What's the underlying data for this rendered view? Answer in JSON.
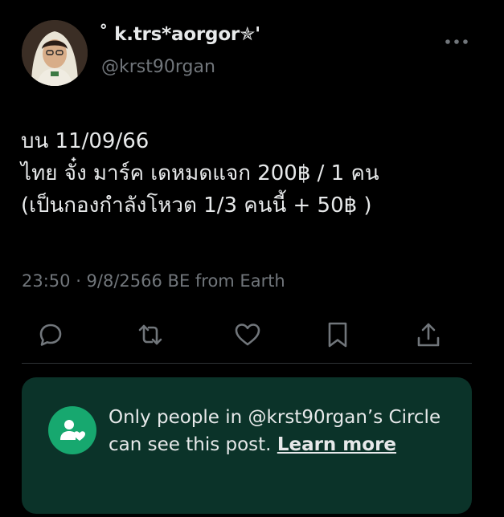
{
  "author": {
    "display_name": "˚ k.trs*aorgor✯'",
    "handle": "@krst90rgan"
  },
  "tweet": {
    "lines": [
      "บน 11/09/66",
      "ไทย จั๋ง มาร์ค เดหมดแจก 200฿ / 1 คน",
      "(เป็นกองกำลังโหวต 1/3 คนนี้ + 50฿ )"
    ],
    "timestamp": "23:50 · 9/8/2566 BE from Earth"
  },
  "actions": {
    "reply_icon": "reply-icon",
    "repost_icon": "repost-icon",
    "like_icon": "heart-icon",
    "bookmark_icon": "bookmark-icon",
    "share_icon": "share-icon"
  },
  "circle_notice": {
    "text": "Only people in @krst90rgan’s Circle can see this post.",
    "link_label": "Learn more",
    "icon": "circle-people-heart-icon"
  },
  "colors": {
    "background": "#000000",
    "primary_text": "#e7e9ea",
    "secondary_text": "#71767b",
    "notice_background": "#0b3329",
    "notice_icon": "#17a86f"
  }
}
